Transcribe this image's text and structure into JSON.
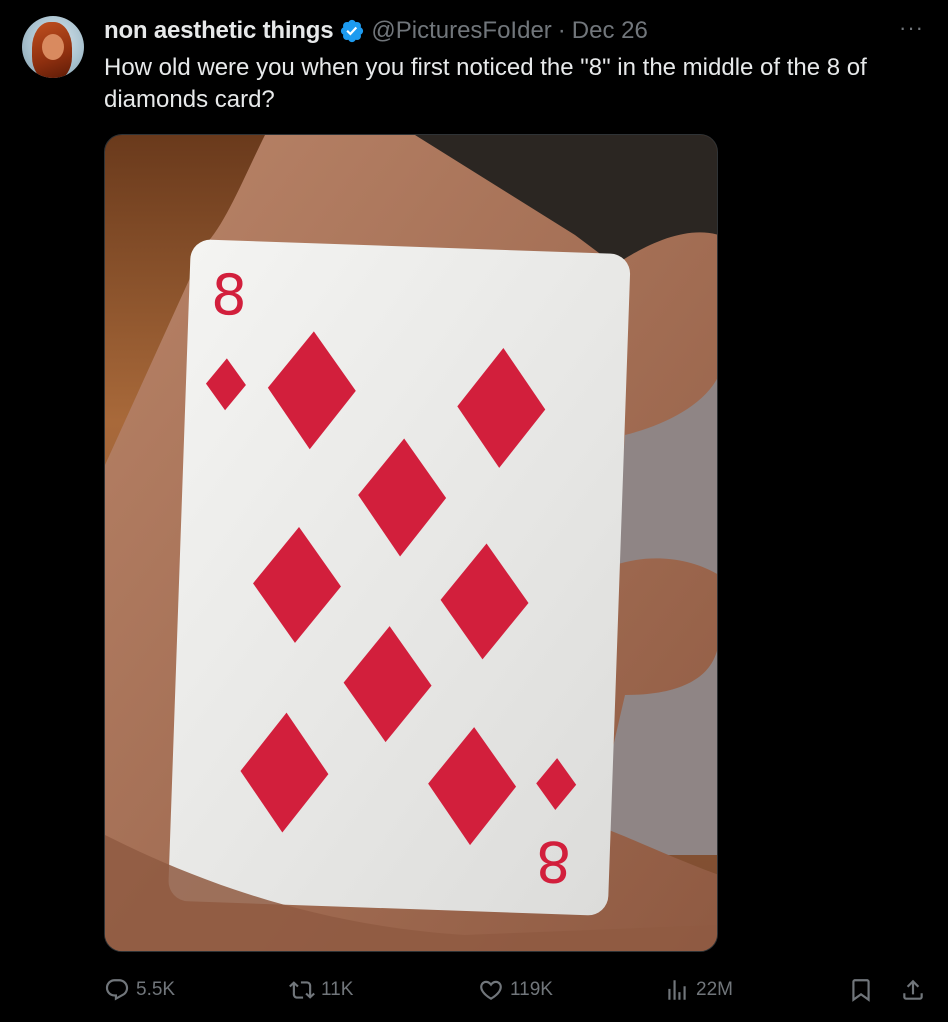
{
  "author": {
    "name": "non aesthetic things",
    "handle": "@PicturesFoIder",
    "separator": "·",
    "date": "Dec 26",
    "verified": true
  },
  "tweet_text": "How old were you when you first noticed the \"8\" in the middle of the 8 of diamonds card?",
  "media": {
    "card_rank": "8",
    "suit": "diamonds",
    "suit_color": "#d21f3c"
  },
  "actions": {
    "replies": "5.5K",
    "reposts": "11K",
    "likes": "119K",
    "views": "22M"
  },
  "icons": {
    "more": "more-dots-icon",
    "reply": "reply-icon",
    "repost": "repost-icon",
    "like": "heart-icon",
    "views": "views-chart-icon",
    "bookmark": "bookmark-icon",
    "share": "share-icon",
    "verified": "verified-badge-icon"
  },
  "colors": {
    "background": "#000000",
    "text": "#e7e9ea",
    "muted": "#71767b",
    "verified_blue": "#1d9bf0"
  }
}
